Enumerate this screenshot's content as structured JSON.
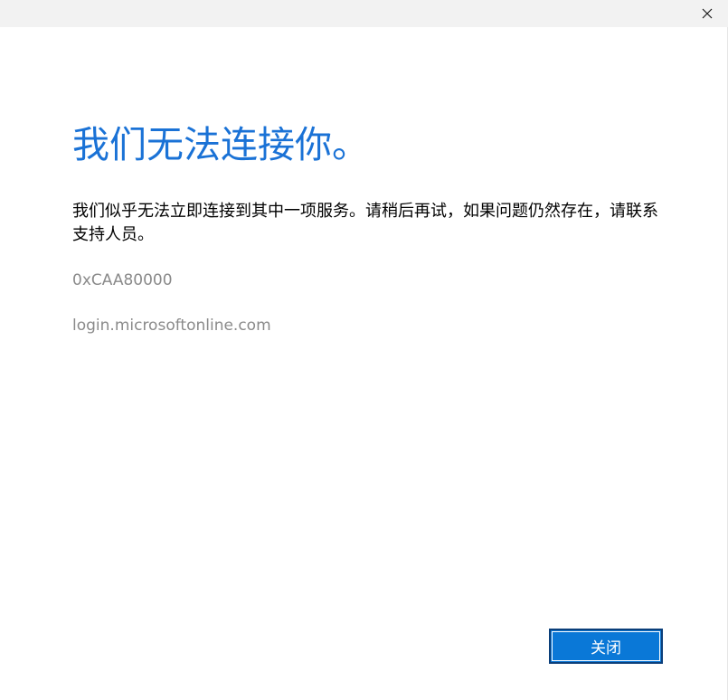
{
  "titlebar": {
    "close_icon": "close-icon"
  },
  "main": {
    "heading": "我们无法连接你。",
    "message": "我们似乎无法立即连接到其中一项服务。请稍后再试，如果问题仍然存在，请联系支持人员。",
    "error_code": "0xCAA80000",
    "host": "login.microsoftonline.com"
  },
  "footer": {
    "close_label": "关闭"
  },
  "colors": {
    "heading": "#1a72d6",
    "button_bg": "#0a78d7",
    "button_border": "#0b3f7a",
    "muted_text": "#8a8a8a",
    "titlebar_bg": "#f2f2f2"
  }
}
